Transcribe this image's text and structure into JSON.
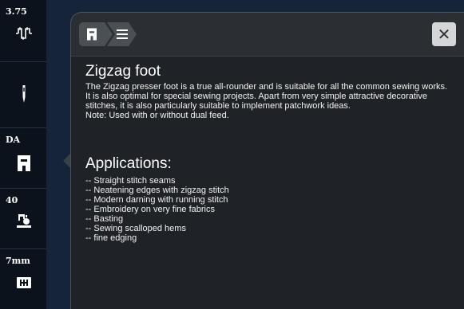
{
  "sidebar": {
    "items": [
      {
        "label": "3.75",
        "icon": "stitch-length-icon"
      },
      {
        "label": "",
        "icon": "needle-icon"
      },
      {
        "label": "DA",
        "icon": "presser-foot-icon"
      },
      {
        "label": "40",
        "icon": "foot-pressure-icon"
      },
      {
        "label": "7mm",
        "icon": "stitch-plate-icon"
      }
    ]
  },
  "dialog": {
    "breadcrumb": {
      "foot_icon": "presser-foot-icon",
      "menu_icon": "menu-icon"
    },
    "close_label": "✕",
    "title": "Zigzag foot",
    "description": [
      "The Zigzag presser foot is a true all-rounder and is suitable for all the common sewing works. It is also optimal for special sewing projects. Apart from very simple attractive decorative stitches, it is also particularly suitable to implement patchwork ideas.",
      "Note: Used with or without dual feed."
    ],
    "applications_title": "Applications:",
    "applications": [
      "-- Straight stitch seams",
      "-- Neatening edges with zigzag stitch",
      "-- Modern darning with running stitch",
      "-- Embroidery on very fine fabrics",
      "-- Basting",
      "-- Sewing scalloped hems",
      "-- fine edging"
    ]
  },
  "colors": {
    "sidebar_bg": "#0c121b",
    "dialog_bg": "#2b2f33",
    "content_bg": "#1f2226",
    "close_bg": "#d4d6d8"
  }
}
